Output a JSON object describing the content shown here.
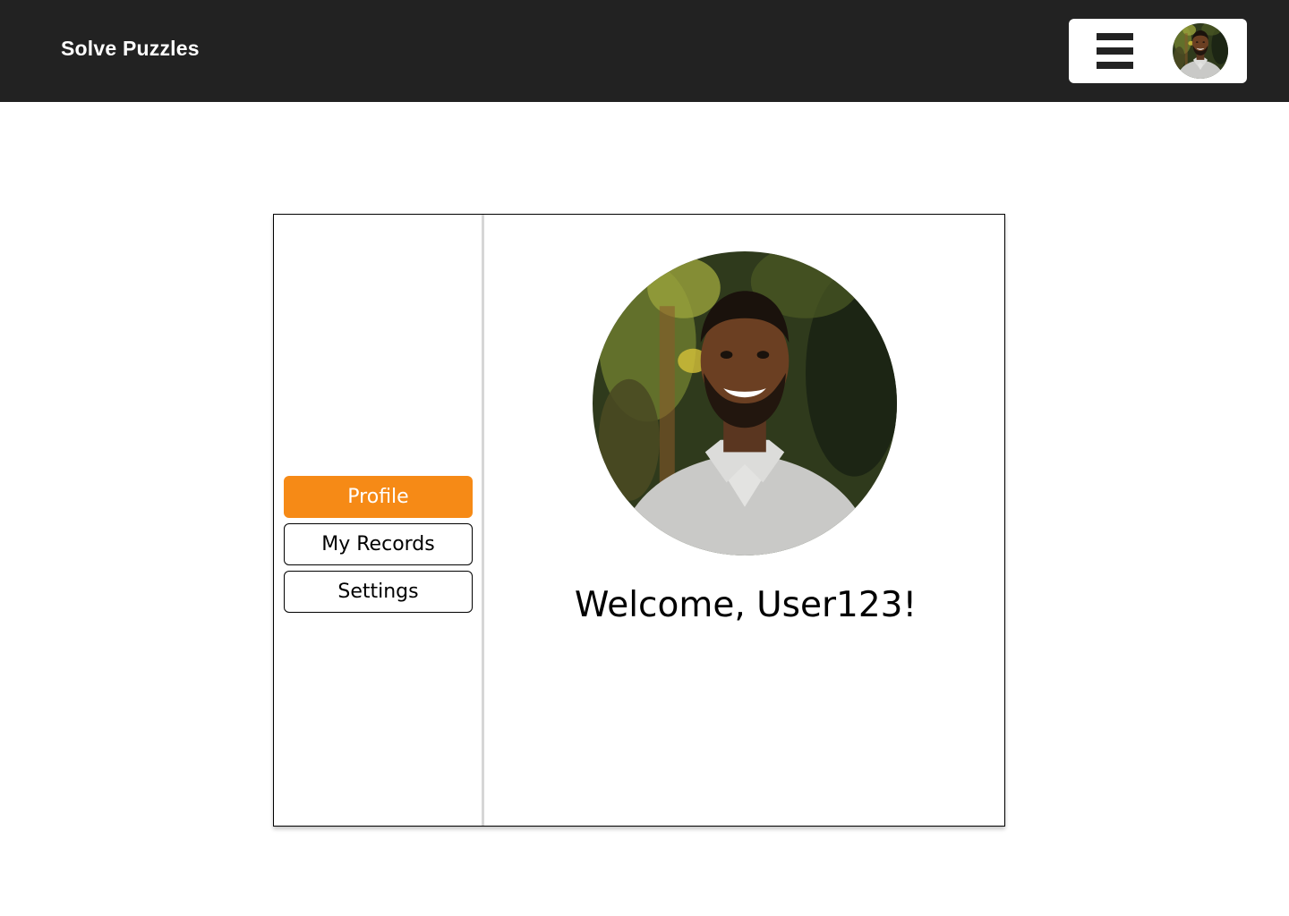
{
  "header": {
    "brand": "Solve Puzzles",
    "menu_icon": "hamburger-menu-icon",
    "avatar_icon": "user-avatar"
  },
  "sidebar": {
    "items": [
      {
        "label": "Profile",
        "active": true
      },
      {
        "label": "My Records",
        "active": false
      },
      {
        "label": "Settings",
        "active": false
      }
    ]
  },
  "main": {
    "welcome": "Welcome, User123!"
  },
  "colors": {
    "topbar": "#222222",
    "accent": "#F68A16",
    "divider": "#D6D6D6"
  }
}
